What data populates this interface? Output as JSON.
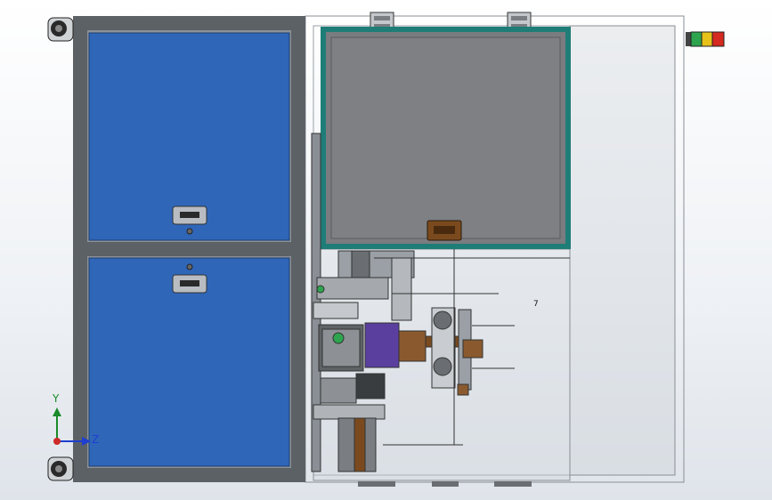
{
  "viewport": {
    "triad": {
      "y_label": "Y",
      "z_label": "Z"
    },
    "annotation": "7"
  },
  "colors": {
    "frame": "#5c6166",
    "panel_blue": "#2f66b8",
    "glass_panel": "#7a7c80",
    "door_frame_teal": "#1f7d78",
    "handle_brown": "#7a4a1e",
    "motor_purple": "#5a3f9e",
    "tower_light": [
      "#2ea44f",
      "#e6c21a",
      "#d42a1f"
    ]
  },
  "icons": {
    "tower_light": "signal-tower-light-icon",
    "caster": "caster-wheel-icon",
    "hinge": "hinge-icon",
    "handle": "drawer-handle-icon",
    "triad": "coordinate-triad-icon"
  }
}
